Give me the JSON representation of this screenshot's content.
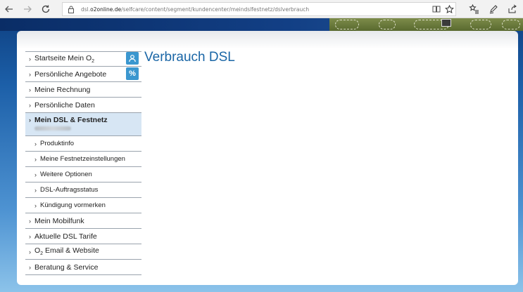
{
  "browser": {
    "url_prefix": "dsl.",
    "url_domain": "o2online.de",
    "url_path": "/selfcare/content/segment/kundencenter/meindslfestnetz/dslverbrauch",
    "icons": [
      "back-icon",
      "forward-icon",
      "refresh-icon",
      "lock-icon",
      "reading-view-icon",
      "favorite-star-icon",
      "favorites-hub-icon",
      "web-note-icon",
      "share-icon"
    ]
  },
  "page": {
    "title": "Verbrauch DSL"
  },
  "sidebar": {
    "items": [
      {
        "label": "Startseite Mein O",
        "sub": "2"
      },
      {
        "label": "Persönliche Angebote"
      },
      {
        "label": "Meine Rechnung"
      },
      {
        "label": "Persönliche Daten"
      },
      {
        "label": "Mein DSL & Festnetz"
      },
      {
        "label": "Produktinfo"
      },
      {
        "label": "Meine Festnetzeinstellungen"
      },
      {
        "label": "Weitere Optionen"
      },
      {
        "label": "DSL-Auftragsstatus"
      },
      {
        "label": "Kündigung vormerken"
      },
      {
        "label": "Mein Mobilfunk"
      },
      {
        "label": "Aktuelle DSL Tarife"
      },
      {
        "label": " Email & Website",
        "prefix": "O",
        "sub": "2"
      },
      {
        "label": "Beratung & Service"
      }
    ],
    "badges": [
      {
        "icon": "user-icon",
        "glyph": "👤"
      },
      {
        "icon": "percent-icon",
        "glyph": "%"
      }
    ]
  }
}
